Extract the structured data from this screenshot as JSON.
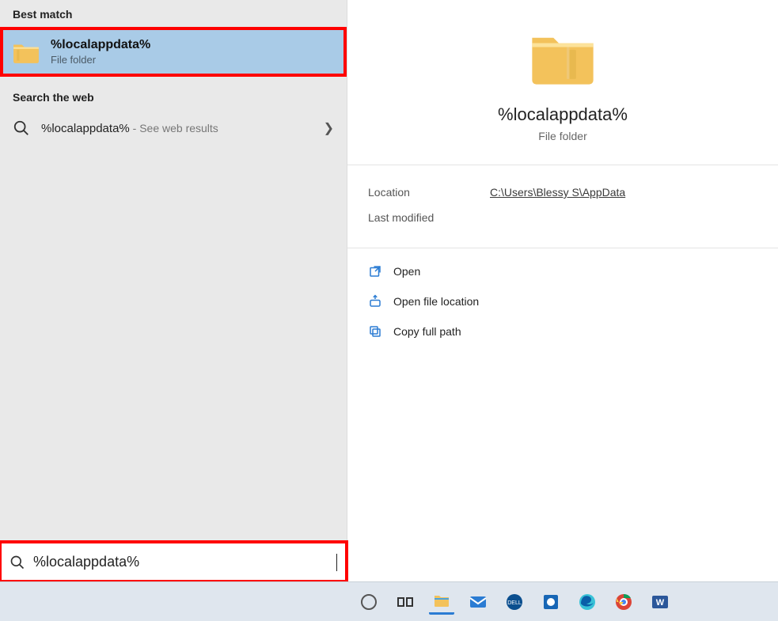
{
  "left": {
    "best_match_header": "Best match",
    "best_match": {
      "title": "%localappdata%",
      "subtitle": "File folder"
    },
    "web_header": "Search the web",
    "web_result": {
      "title": "%localappdata%",
      "suffix": " - See web results"
    }
  },
  "detail": {
    "title": "%localappdata%",
    "subtitle": "File folder",
    "location_label": "Location",
    "location_value": "C:\\Users\\Blessy S\\AppData",
    "modified_label": "Last modified",
    "modified_value": ""
  },
  "actions": {
    "open": "Open",
    "open_location": "Open file location",
    "copy_path": "Copy full path"
  },
  "search": {
    "value": "%localappdata%"
  },
  "taskbar": {
    "cortana": "cortana",
    "taskview": "task-view",
    "explorer": "file-explorer",
    "mail": "mail",
    "dell": "dell",
    "dell2": "dell-support",
    "edge": "edge",
    "chrome": "chrome",
    "word": "word"
  }
}
